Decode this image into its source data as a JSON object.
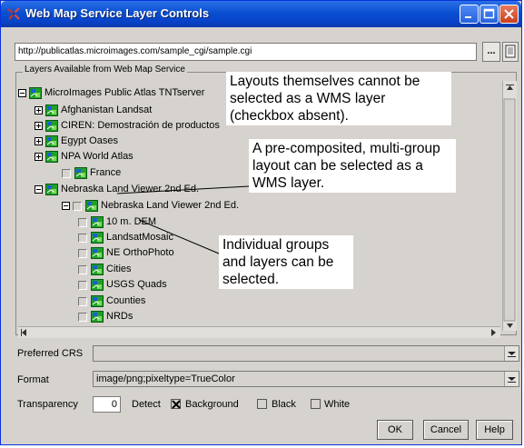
{
  "window": {
    "title": "Web Map Service Layer Controls"
  },
  "url": {
    "value": "http://publicatlas.microimages.com/sample_cgi/sample.cgi",
    "browse_label": "..."
  },
  "layers_group": {
    "label": "Layers Available from Web Map Service"
  },
  "tree": [
    {
      "label": "MicroImages Public Atlas TNTserver",
      "expander": "minus",
      "checkbox": false
    },
    {
      "label": "Afghanistan Landsat",
      "expander": "plus",
      "checkbox": false
    },
    {
      "label": "CIREN: Demostración de productos",
      "expander": "plus",
      "checkbox": false
    },
    {
      "label": "Egypt Oases",
      "expander": "plus",
      "checkbox": false
    },
    {
      "label": "NPA World Atlas",
      "expander": "plus",
      "checkbox": false
    },
    {
      "label": "France",
      "expander": "none",
      "checkbox": true
    },
    {
      "label": "Nebraska Land Viewer 2nd Ed.",
      "expander": "minus",
      "checkbox": false
    },
    {
      "label": "Nebraska Land Viewer 2nd Ed.",
      "expander": "minus",
      "checkbox": true
    },
    {
      "label": "10 m. DEM",
      "expander": "none",
      "checkbox": true
    },
    {
      "label": "LandsatMosaic",
      "expander": "none",
      "checkbox": true
    },
    {
      "label": "NE OrthoPhoto",
      "expander": "none",
      "checkbox": true
    },
    {
      "label": "Cities",
      "expander": "none",
      "checkbox": true
    },
    {
      "label": "USGS Quads",
      "expander": "none",
      "checkbox": true
    },
    {
      "label": "Counties",
      "expander": "none",
      "checkbox": true
    },
    {
      "label": "NRDs",
      "expander": "none",
      "checkbox": true
    }
  ],
  "callouts": {
    "layouts": "Layouts themselves cannot be selected as a WMS layer (checkbox absent).",
    "precomposed": "A pre-composited, multi-group layout can be selected as a WMS layer.",
    "individual": "Individual groups and layers can be selected."
  },
  "preferred_crs": {
    "label": "Preferred CRS",
    "value": ""
  },
  "format": {
    "label": "Format",
    "value": "image/png;pixeltype=TrueColor"
  },
  "transparency": {
    "label": "Transparency",
    "value": "0",
    "detect_label": "Detect",
    "options": [
      {
        "label": "Background",
        "checked": true
      },
      {
        "label": "Black",
        "checked": false
      },
      {
        "label": "White",
        "checked": false
      }
    ]
  },
  "buttons": {
    "ok": "OK",
    "cancel": "Cancel",
    "help": "Help"
  },
  "colors": {
    "titlebar": "#0a4fd1",
    "dialog_bg": "#d6d3ce",
    "group_icon_green": "#1fa02a",
    "group_icon_blue": "#1b5fd0"
  }
}
